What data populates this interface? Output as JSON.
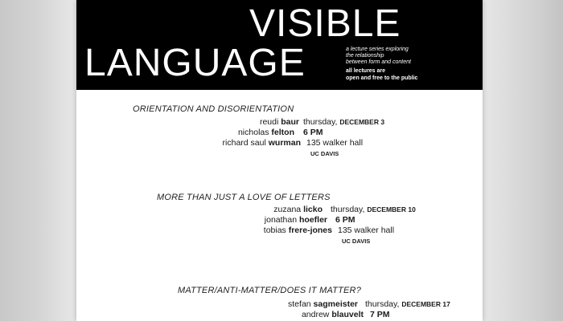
{
  "header": {
    "title_line1": "VISIBLE",
    "title_line2": "LANGUAGE",
    "tagline_lines": [
      "a lecture series exploring",
      "the relationship",
      "between form and content"
    ],
    "notice_lines": [
      "all lectures are",
      "open and free to the public"
    ]
  },
  "sessions": [
    {
      "title": "ORIENTATION AND DISORIENTATION",
      "speakers": [
        {
          "first": "reudi ",
          "last": "baur"
        },
        {
          "first": "nicholas ",
          "last": "felton"
        },
        {
          "first": "richard saul ",
          "last": "wurman"
        }
      ],
      "day": "thursday,",
      "date": "DECEMBER 3",
      "time": "6 PM",
      "place": "135 walker hall",
      "venue": "UC DAVIS"
    },
    {
      "title": "MORE THAN JUST A LOVE OF LETTERS",
      "speakers": [
        {
          "first": "zuzana ",
          "last": "licko"
        },
        {
          "first": "jonathan ",
          "last": "hoefler"
        },
        {
          "first": "tobias ",
          "last": "frere-jones"
        }
      ],
      "day": "thursday,",
      "date": "DECEMBER 10",
      "time": "6 PM",
      "place": "135 walker hall",
      "venue": "UC DAVIS"
    },
    {
      "title": "MATTER/ANTI-MATTER/DOES IT MATTER?",
      "speakers": [
        {
          "first": "stefan ",
          "last": "sagmeister"
        },
        {
          "first": "andrew ",
          "last": "blauvelt"
        }
      ],
      "day": "thursday,",
      "date": "DECEMBER 17",
      "time": "7 PM"
    }
  ]
}
